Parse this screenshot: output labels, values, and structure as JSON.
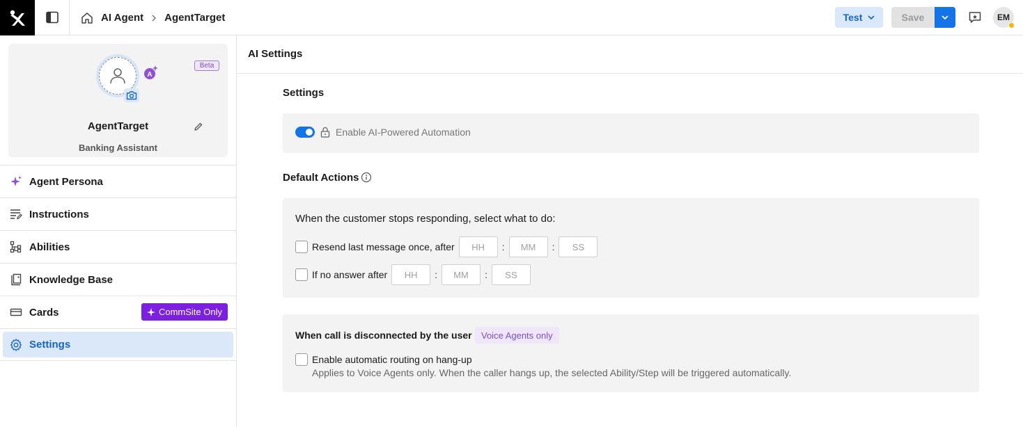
{
  "header": {
    "breadcrumb": [
      "AI Agent",
      "AgentTarget"
    ],
    "test_label": "Test",
    "save_label": "Save",
    "user_initials": "EM"
  },
  "agent": {
    "name": "AgentTarget",
    "role": "Banking Assistant",
    "beta_label": "Beta"
  },
  "sidebar": {
    "items": [
      {
        "label": "Agent Persona",
        "icon": "sparkle-icon"
      },
      {
        "label": "Instructions",
        "icon": "instructions-icon"
      },
      {
        "label": "Abilities",
        "icon": "abilities-icon"
      },
      {
        "label": "Knowledge Base",
        "icon": "knowledge-base-icon"
      },
      {
        "label": "Cards",
        "icon": "cards-icon",
        "badge": "CommSite Only"
      },
      {
        "label": "Settings",
        "icon": "gear-icon",
        "selected": true
      }
    ]
  },
  "main": {
    "title": "AI Settings",
    "settings_heading": "Settings",
    "automation_toggle": {
      "label": "Enable AI-Powered Automation",
      "on": true,
      "locked": true
    },
    "default_actions_heading": "Default Actions",
    "default_actions": {
      "prompt": "When the customer stops responding, select what to do:",
      "resend_label": "Resend last message once, after",
      "no_answer_label": "If no answer after",
      "placeholders": {
        "hh": "HH",
        "mm": "MM",
        "ss": "SS"
      },
      "colon": ":"
    },
    "call_disconnect": {
      "heading": "When call is disconnected by the user",
      "tag": "Voice Agents only",
      "checkbox_label": "Enable automatic routing on hang-up",
      "helper": "Applies to Voice Agents only. When the caller hangs up, the selected Ability/Step will be triggered automatically."
    }
  },
  "colors": {
    "primary": "#1473e6",
    "selected_bg": "#dbe8fa",
    "commsite_badge": "#7c1fe0",
    "panel_bg": "#f3f3f3"
  }
}
